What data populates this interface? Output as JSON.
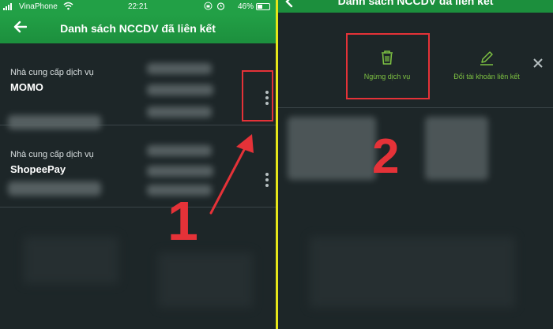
{
  "status_bar": {
    "carrier": "VinaPhone",
    "time": "22:21",
    "battery_percent": "46%",
    "battery_level": 0.46
  },
  "header": {
    "back_icon": "arrow-left-icon",
    "title": "Danh sách NCCDV đã liên kết"
  },
  "providers": [
    {
      "label": "Nhà cung cấp dịch vụ",
      "name": "MOMO"
    },
    {
      "label": "Nhà cung cấp dịch vụ",
      "name": "ShopeePay"
    }
  ],
  "annotations": {
    "step1": "1",
    "step2": "2",
    "color": "#e53238"
  },
  "actions": {
    "stop_service": {
      "label": "Ngừng dịch vụ",
      "icon": "trash-icon"
    },
    "change_account": {
      "label": "Đổi tài khoản liên kết",
      "icon": "pencil-icon"
    },
    "close_icon": "close-icon"
  },
  "colors": {
    "brand_green": "#22a046",
    "background": "#1d2628",
    "action_green": "#7dc142",
    "divider": "#e6e619"
  }
}
